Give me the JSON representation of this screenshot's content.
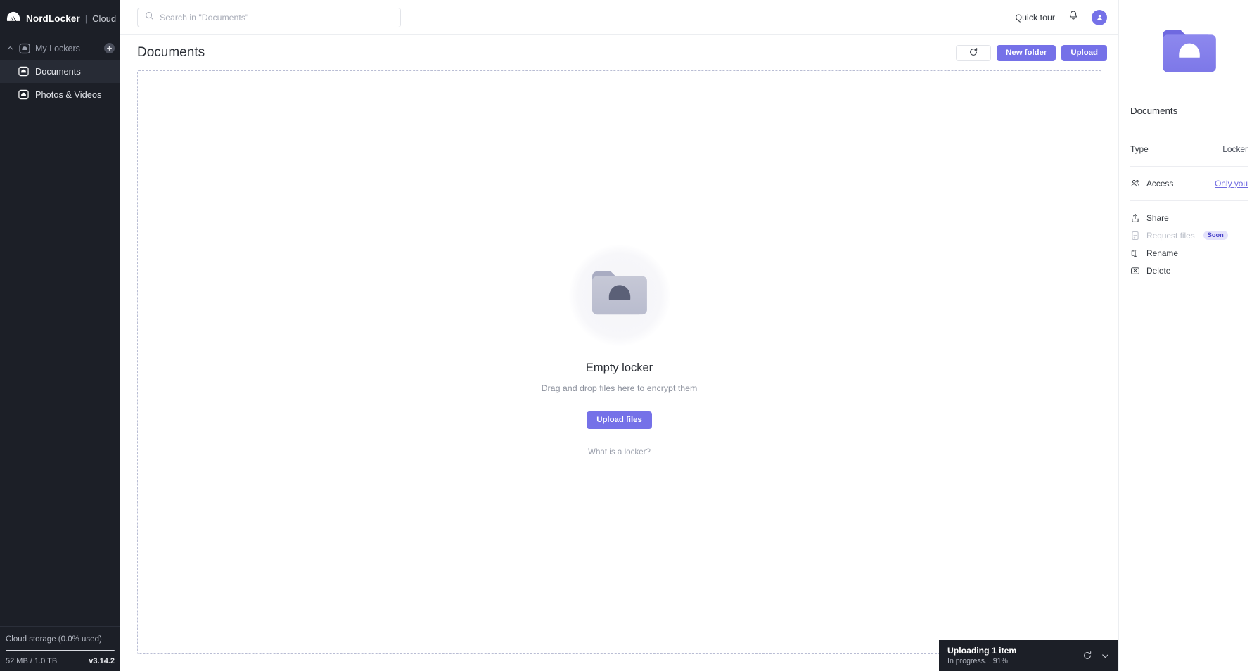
{
  "brand": {
    "name": "NordLocker",
    "separator": "|",
    "product": "Cloud",
    "logo_icon": "nordlocker-mountain-icon"
  },
  "sidebar": {
    "group": {
      "label": "My Lockers",
      "chevron_icon": "chevron-up-icon",
      "locker_icon": "locker-icon",
      "add_icon": "plus-icon"
    },
    "items": [
      {
        "label": "Documents",
        "icon": "locker-icon",
        "active": true
      },
      {
        "label": "Photos & Videos",
        "icon": "locker-icon",
        "active": false
      }
    ],
    "storage": {
      "label": "Cloud storage (0.0% used)",
      "used": "52 MB / 1.0 TB",
      "version": "v3.14.2",
      "percent": 0.0
    }
  },
  "topbar": {
    "search": {
      "placeholder": "Search in \"Documents\"",
      "value": "",
      "icon": "search-icon"
    },
    "quick_tour": "Quick tour",
    "bell_icon": "bell-icon",
    "avatar_icon": "user-avatar-icon",
    "avatar_color": "#7571e8"
  },
  "page": {
    "title": "Documents",
    "actions": {
      "refresh_icon": "refresh-icon",
      "new_folder": "New folder",
      "upload": "Upload"
    }
  },
  "empty_state": {
    "folder_icon": "folder-nordlocker-icon",
    "title": "Empty locker",
    "subtitle": "Drag and drop files here to encrypt them",
    "upload_button": "Upload files",
    "help_link": "What is a locker?"
  },
  "details": {
    "hero_icon": "folder-purple-nordlocker-icon",
    "name": "Documents",
    "rows": [
      {
        "key": "Type",
        "value": "Locker",
        "icon": null,
        "link": false
      },
      {
        "key": "Access",
        "value": "Only you",
        "icon": "people-icon",
        "link": true
      }
    ],
    "actions": [
      {
        "label": "Share",
        "icon": "share-upload-icon",
        "disabled": false,
        "badge": null
      },
      {
        "label": "Request files",
        "icon": "request-files-icon",
        "disabled": true,
        "badge": "Soon"
      },
      {
        "label": "Rename",
        "icon": "rename-icon",
        "disabled": false,
        "badge": null
      },
      {
        "label": "Delete",
        "icon": "delete-x-icon",
        "disabled": false,
        "badge": null
      }
    ]
  },
  "toast": {
    "title": "Uploading 1 item",
    "subtitle": "In progress... 91%",
    "progress_percent": 91,
    "spinner_icon": "refresh-spinner-icon",
    "collapse_icon": "chevron-down-icon"
  },
  "theme": {
    "accent": "#7571e8",
    "sidebar_bg": "#1c1f27",
    "sidebar_active": "#272b35",
    "badge_bg": "#e4e2fb",
    "badge_text": "#4b45c9",
    "dashed_border": "#b9bdd4"
  }
}
